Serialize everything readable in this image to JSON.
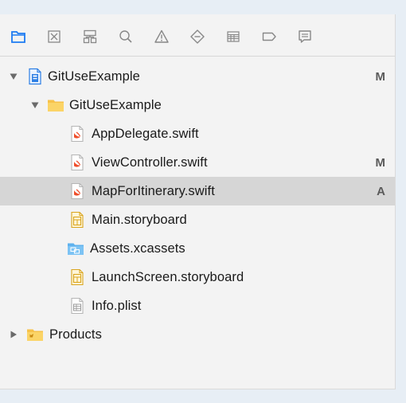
{
  "navigator": {
    "toolbar_icons": [
      "project-navigator-icon",
      "source-control-navigator-icon",
      "symbol-navigator-icon",
      "find-navigator-icon",
      "issue-navigator-icon",
      "test-navigator-icon",
      "debug-navigator-icon",
      "breakpoint-navigator-icon",
      "report-navigator-icon"
    ],
    "accent_color": "#1d7bf2",
    "tree": {
      "project": {
        "name": "GitUseExample",
        "status": "M",
        "expanded": true
      },
      "group": {
        "name": "GitUseExample",
        "expanded": true
      },
      "files": [
        {
          "name": "AppDelegate.swift",
          "status": "",
          "icon": "swift-file-icon"
        },
        {
          "name": "ViewController.swift",
          "status": "M",
          "icon": "swift-file-icon"
        },
        {
          "name": "MapForItinerary.swift",
          "status": "A",
          "icon": "swift-file-icon",
          "selected": true
        },
        {
          "name": "Main.storyboard",
          "status": "",
          "icon": "storyboard-file-icon"
        },
        {
          "name": "Assets.xcassets",
          "status": "",
          "icon": "asset-catalog-icon"
        },
        {
          "name": "LaunchScreen.storyboard",
          "status": "",
          "icon": "storyboard-file-icon"
        },
        {
          "name": "Info.plist",
          "status": "",
          "icon": "plist-file-icon"
        }
      ],
      "products": {
        "name": "Products",
        "expanded": false
      }
    }
  }
}
